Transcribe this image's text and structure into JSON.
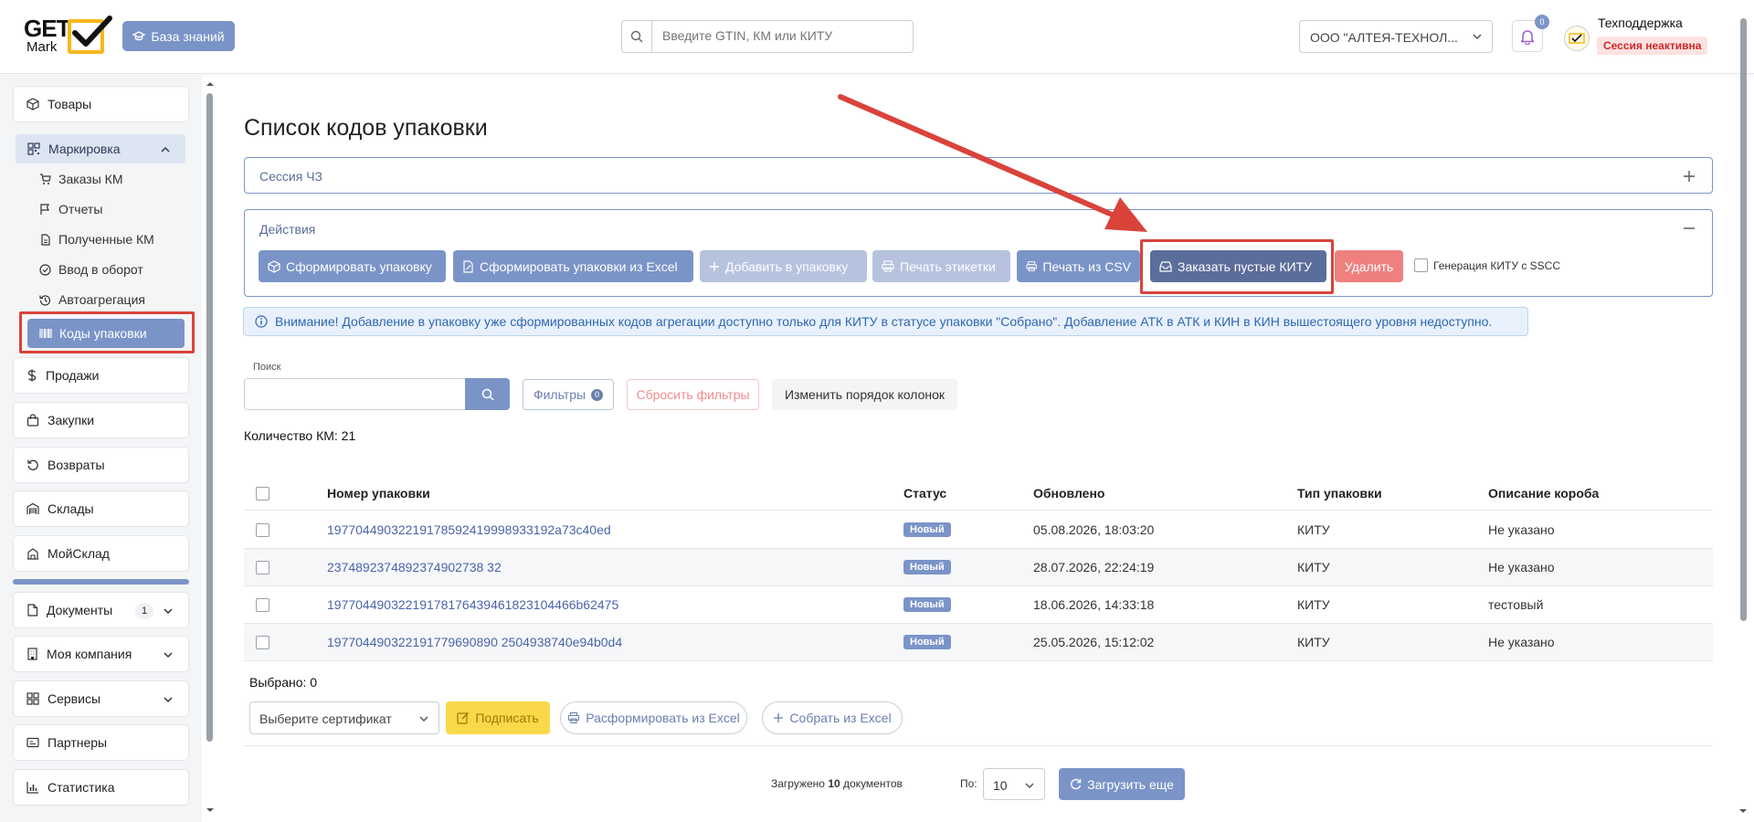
{
  "header": {
    "logo_get": "GET",
    "logo_mark": "Mark",
    "knowledge_base": "База знаний",
    "search_placeholder": "Введите GTIN, КМ или КИТУ",
    "organization": "ООО \"АЛТЕЯ-ТЕХНОЛ...",
    "notifications_count": "0",
    "user_name": "Техподдержка",
    "session_status": "Сессия неактивна"
  },
  "sidebar": {
    "products": "Товары",
    "marking": "Маркировка",
    "sub": [
      "Заказы КМ",
      "Отчеты",
      "Полученные КМ",
      "Ввод в оборот",
      "Автоагрегация",
      "Коды упаковки"
    ],
    "sales": "Продажи",
    "purchases": "Закупки",
    "returns": "Возвраты",
    "warehouses": "Склады",
    "moysklad": "МойСклад",
    "documents": "Документы",
    "documents_badge": "1",
    "my_company": "Моя компания",
    "services": "Сервисы",
    "partners": "Партнеры",
    "statistics": "Статистика"
  },
  "page": {
    "title": "Список кодов упаковки",
    "session_cz": "Сессия ЧЗ",
    "actions": "Действия",
    "buttons": {
      "form_pack": "Сформировать упаковку",
      "form_from_excel": "Сформировать упаковки из Excel",
      "add_to_pack": "Добавить в упаковку",
      "print_labels": "Печать этикетки",
      "print_csv": "Печать из CSV",
      "order_empty": "Заказать пустые КИТУ",
      "delete": "Удалить",
      "gen_kitu": "Генерация КИТУ с SSCC"
    },
    "info": "Внимание! Добавление в упаковку уже сформированных кодов агрегации доступно только для КИТУ в статусе упаковки \"Собрано\". Добавление АТК в АТК и КИН в КИН вышестоящего уровня недоступно.",
    "search_label": "Поиск",
    "filters": "Фильтры",
    "filters_count": "0",
    "reset_filters": "Сбросить фильтры",
    "reorder_columns": "Изменить порядок колонок",
    "count": "Количество КМ: 21"
  },
  "table": {
    "columns": [
      "Номер упаковки",
      "Статус",
      "Обновлено",
      "Тип упаковки",
      "Описание короба"
    ],
    "rows": [
      {
        "number": "19770449032219178592419998933192a73c40ed",
        "status": "Новый",
        "updated": "05.08.2026, 18:03:20",
        "type": "КИТУ",
        "desc": "Не указано"
      },
      {
        "number": "2374892374892374902738 32",
        "status": "Новый",
        "updated": "28.07.2026, 22:24:19",
        "type": "КИТУ",
        "desc": "Не указано"
      },
      {
        "number": "19770449032219178176439461823104466b62475",
        "status": "Новый",
        "updated": "18.06.2026, 14:33:18",
        "type": "КИТУ",
        "desc": "тестовый"
      },
      {
        "number": "197704490322191779690890 2504938740e94b0d4",
        "status": "Новый",
        "updated": "25.05.2026, 15:12:02",
        "type": "КИТУ",
        "desc": "Не указано"
      }
    ]
  },
  "footer": {
    "selected": "Выбрано: 0",
    "certificate_placeholder": "Выберите сертификат",
    "sign": "Подписать",
    "disband_excel": "Расформировать из Excel",
    "assemble_excel": "Собрать из Excel",
    "loaded_prefix": "Загружено ",
    "loaded_count": "10",
    "loaded_suffix": " документов",
    "per_page_label": "По:",
    "per_page": "10",
    "load_more": "Загрузить еще"
  },
  "colors": {
    "accent": "#7b94c8",
    "annotation_red": "#d9433b",
    "logo_yellow": "#f6b81c",
    "danger": "#f08080",
    "sign_yellow": "#f9d94a"
  }
}
